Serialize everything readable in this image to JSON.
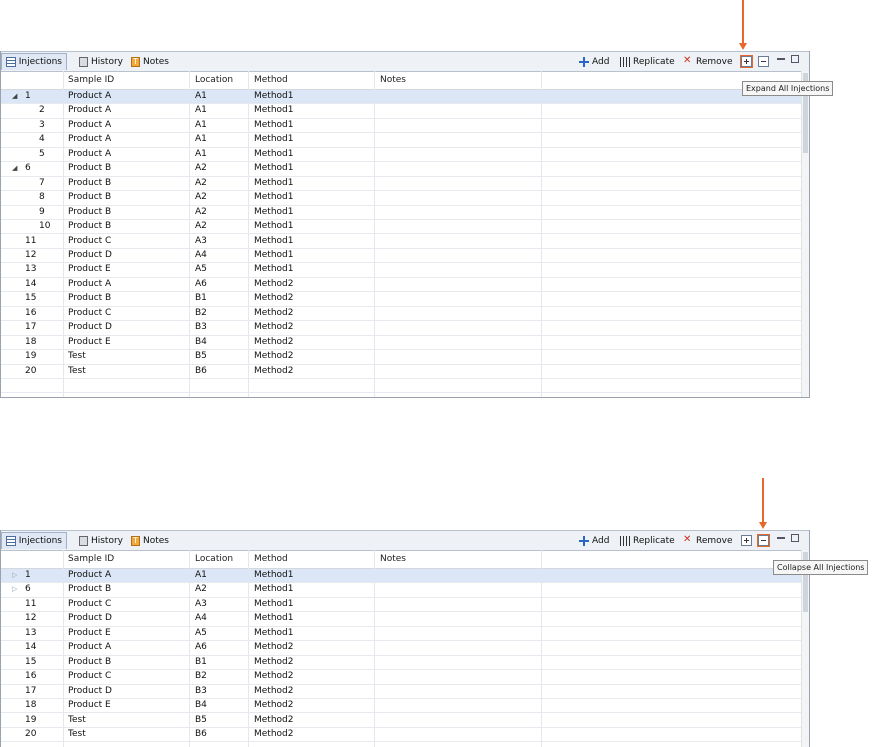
{
  "tabs": [
    {
      "label": "Injections",
      "icon": "grid-icon"
    },
    {
      "label": "History",
      "icon": "history-icon"
    },
    {
      "label": "Notes",
      "icon": "notes-icon"
    }
  ],
  "toolbar": {
    "add_label": "Add",
    "replicate_label": "Replicate",
    "remove_label": "Remove"
  },
  "columns": [
    "Sample ID",
    "Location",
    "Method",
    "Notes"
  ],
  "accent_color": "#e8672b",
  "expanded_view": {
    "tooltip": "Expand All Injections",
    "rows": [
      {
        "num": "1",
        "indent": false,
        "toggle": "expanded",
        "sample": "Product A",
        "location": "A1",
        "method": "Method1",
        "selected": true
      },
      {
        "num": "2",
        "indent": true,
        "toggle": "",
        "sample": "Product A",
        "location": "A1",
        "method": "Method1"
      },
      {
        "num": "3",
        "indent": true,
        "toggle": "",
        "sample": "Product A",
        "location": "A1",
        "method": "Method1"
      },
      {
        "num": "4",
        "indent": true,
        "toggle": "",
        "sample": "Product A",
        "location": "A1",
        "method": "Method1"
      },
      {
        "num": "5",
        "indent": true,
        "toggle": "",
        "sample": "Product A",
        "location": "A1",
        "method": "Method1"
      },
      {
        "num": "6",
        "indent": false,
        "toggle": "expanded",
        "sample": "Product B",
        "location": "A2",
        "method": "Method1"
      },
      {
        "num": "7",
        "indent": true,
        "toggle": "",
        "sample": "Product B",
        "location": "A2",
        "method": "Method1"
      },
      {
        "num": "8",
        "indent": true,
        "toggle": "",
        "sample": "Product B",
        "location": "A2",
        "method": "Method1"
      },
      {
        "num": "9",
        "indent": true,
        "toggle": "",
        "sample": "Product B",
        "location": "A2",
        "method": "Method1"
      },
      {
        "num": "10",
        "indent": true,
        "toggle": "",
        "sample": "Product B",
        "location": "A2",
        "method": "Method1"
      },
      {
        "num": "11",
        "indent": false,
        "toggle": "",
        "sample": "Product C",
        "location": "A3",
        "method": "Method1"
      },
      {
        "num": "12",
        "indent": false,
        "toggle": "",
        "sample": "Product D",
        "location": "A4",
        "method": "Method1"
      },
      {
        "num": "13",
        "indent": false,
        "toggle": "",
        "sample": "Product E",
        "location": "A5",
        "method": "Method1"
      },
      {
        "num": "14",
        "indent": false,
        "toggle": "",
        "sample": "Product A",
        "location": "A6",
        "method": "Method2"
      },
      {
        "num": "15",
        "indent": false,
        "toggle": "",
        "sample": "Product B",
        "location": "B1",
        "method": "Method2"
      },
      {
        "num": "16",
        "indent": false,
        "toggle": "",
        "sample": "Product C",
        "location": "B2",
        "method": "Method2"
      },
      {
        "num": "17",
        "indent": false,
        "toggle": "",
        "sample": "Product D",
        "location": "B3",
        "method": "Method2"
      },
      {
        "num": "18",
        "indent": false,
        "toggle": "",
        "sample": "Product E",
        "location": "B4",
        "method": "Method2"
      },
      {
        "num": "19",
        "indent": false,
        "toggle": "",
        "sample": "Test",
        "location": "B5",
        "method": "Method2"
      },
      {
        "num": "20",
        "indent": false,
        "toggle": "",
        "sample": "Test",
        "location": "B6",
        "method": "Method2"
      },
      {
        "num": "",
        "indent": false,
        "toggle": "",
        "sample": "",
        "location": "",
        "method": ""
      }
    ]
  },
  "collapsed_view": {
    "tooltip": "Collapse All Injections",
    "rows": [
      {
        "num": "1",
        "indent": false,
        "toggle": "collapsed",
        "sample": "Product A",
        "location": "A1",
        "method": "Method1",
        "selected": true
      },
      {
        "num": "6",
        "indent": false,
        "toggle": "collapsed",
        "sample": "Product B",
        "location": "A2",
        "method": "Method1"
      },
      {
        "num": "11",
        "indent": false,
        "toggle": "",
        "sample": "Product C",
        "location": "A3",
        "method": "Method1"
      },
      {
        "num": "12",
        "indent": false,
        "toggle": "",
        "sample": "Product D",
        "location": "A4",
        "method": "Method1"
      },
      {
        "num": "13",
        "indent": false,
        "toggle": "",
        "sample": "Product E",
        "location": "A5",
        "method": "Method1"
      },
      {
        "num": "14",
        "indent": false,
        "toggle": "",
        "sample": "Product A",
        "location": "A6",
        "method": "Method2"
      },
      {
        "num": "15",
        "indent": false,
        "toggle": "",
        "sample": "Product B",
        "location": "B1",
        "method": "Method2"
      },
      {
        "num": "16",
        "indent": false,
        "toggle": "",
        "sample": "Product C",
        "location": "B2",
        "method": "Method2"
      },
      {
        "num": "17",
        "indent": false,
        "toggle": "",
        "sample": "Product D",
        "location": "B3",
        "method": "Method2"
      },
      {
        "num": "18",
        "indent": false,
        "toggle": "",
        "sample": "Product E",
        "location": "B4",
        "method": "Method2"
      },
      {
        "num": "19",
        "indent": false,
        "toggle": "",
        "sample": "Test",
        "location": "B5",
        "method": "Method2"
      },
      {
        "num": "20",
        "indent": false,
        "toggle": "",
        "sample": "Test",
        "location": "B6",
        "method": "Method2"
      }
    ]
  }
}
